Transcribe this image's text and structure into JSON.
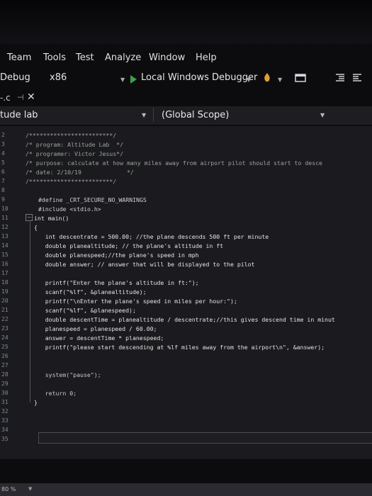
{
  "menu": {
    "items": [
      "Team",
      "Tools",
      "Test",
      "Analyze",
      "Window",
      "Help"
    ]
  },
  "toolbar": {
    "config": "Debug",
    "platform": "x86",
    "debugger": "Local Windows Debugger"
  },
  "tab": {
    "label": "-.c"
  },
  "nav": {
    "project": "tude lab",
    "scope": "(Global Scope)"
  },
  "editor": {
    "line_numbers": [
      "2",
      "3",
      "4",
      "5",
      "6",
      "7",
      "8",
      "9",
      "10",
      "11",
      "12",
      "13",
      "14",
      "15",
      "16",
      "17",
      "18",
      "19",
      "20",
      "21",
      "22",
      "23",
      "24",
      "25",
      "26",
      "27",
      "28",
      "29",
      "30",
      "31",
      "32",
      "33",
      "34",
      "35"
    ],
    "lines": [
      "/************************/",
      "/* program: Altitude Lab  */",
      "/* programer: Victor Jesus*/",
      "/* purpose: calculate at how many miles away from airport pilot should start to desce",
      "/* date: 2/10/19             */",
      "/************************/",
      "",
      "#define _CRT_SECURE_NO_WARNINGS",
      "#include <stdio.h>",
      "int main()",
      "{",
      "    int descentrate = 500.00; //the plane descends 500 ft per minute",
      "    double planealtitude; // the plane's altitude in ft",
      "    double planespeed;//the plane's speed in mph",
      "    double answer; // answer that will be displayed to the pilot",
      "",
      "    printf(\"Enter the plane's altitude in ft:\");",
      "    scanf(\"%lf\", &planealtitude);",
      "    printf(\"\\nEnter the plane's speed in miles per hour:\");",
      "    scanf(\"%lf\", &planespeed);",
      "    double descentTime = planealtitude / descentrate;//this gives descend time in minut",
      "    planespeed = planespeed / 60.00;",
      "    answer = descentTime * planespeed;",
      "    printf(\"please start descending at %lf miles away from the airport\\n\", &answer);",
      "",
      "",
      "    system(\"pause\");",
      "",
      "    return 0;",
      "}"
    ]
  },
  "status": {
    "zoom": "80 %"
  }
}
